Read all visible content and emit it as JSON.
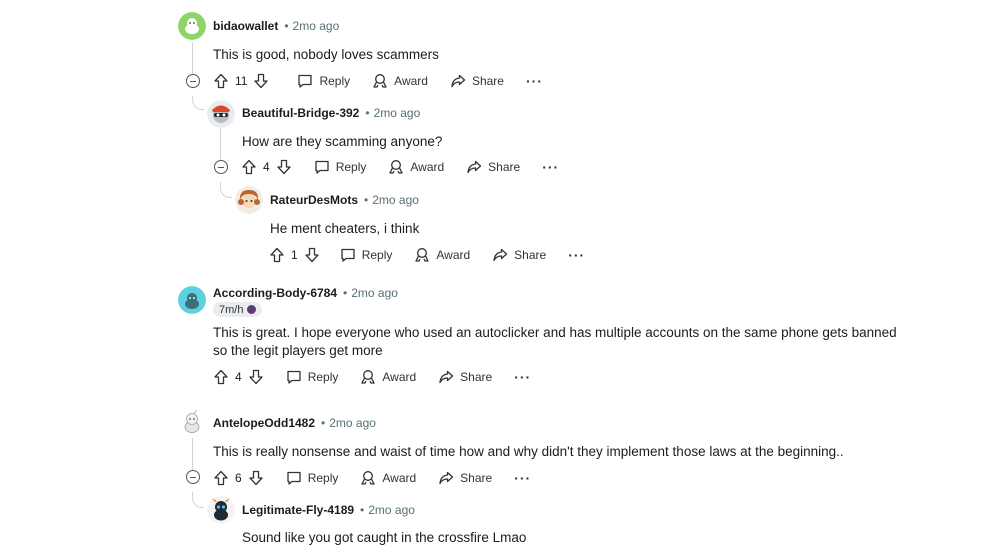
{
  "labels": {
    "reply": "Reply",
    "award": "Award",
    "share": "Share",
    "more": "···",
    "sep": "•"
  },
  "colors": {
    "text": "#1c1c1c",
    "meta": "#576f76",
    "thread": "#d0d4d6"
  },
  "comments": [
    {
      "username": "bidaowallet",
      "time": "2mo ago",
      "body": "This is good, nobody loves scammers",
      "votes": "11",
      "avatar": "green-snoo"
    },
    {
      "username": "Beautiful-Bridge-392",
      "time": "2mo ago",
      "body": "How are they scamming anyone?",
      "votes": "4",
      "avatar": "red-cap-snoo"
    },
    {
      "username": "RateurDesMots",
      "time": "2mo ago",
      "body": "He ment cheaters, i think",
      "votes": "1",
      "avatar": "orange-hair-snoo"
    },
    {
      "username": "According-Body-6784",
      "time": "2mo ago",
      "flair": "7m/h",
      "body_line1": "This is great. I hope everyone who used an autoclicker and has multiple accounts on the same phone gets banned",
      "body_line2": "so the legit players get more",
      "votes": "4",
      "avatar": "teal-snoo"
    },
    {
      "username": "AntelopeOdd1482",
      "time": "2mo ago",
      "body": "This is really nonsense and waist of time how and why didn't they implement those laws at the beginning..",
      "votes": "6",
      "avatar": "grey-snoo"
    },
    {
      "username": "Legitimate-Fly-4189",
      "time": "2mo ago",
      "body": "Sound like you got caught in the crossfire Lmao",
      "avatar": "dark-snoo"
    }
  ]
}
